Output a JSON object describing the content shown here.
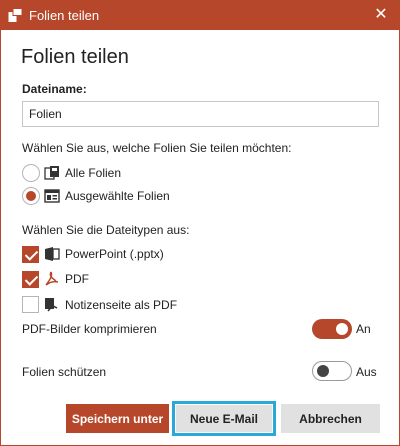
{
  "window": {
    "title": "Folien teilen",
    "close_glyph": "✕"
  },
  "heading": "Folien teilen",
  "filename": {
    "label": "Dateiname:",
    "value": "Folien"
  },
  "slides": {
    "prompt": "Wählen Sie aus, welche Folien Sie teilen möchten:",
    "options": [
      {
        "label": "Alle Folien",
        "icon": "all-slides-icon",
        "selected": false
      },
      {
        "label": "Ausgewählte Folien",
        "icon": "selected-slides-icon",
        "selected": true
      }
    ]
  },
  "filetypes": {
    "prompt": "Wählen Sie die Dateitypen aus:",
    "options": [
      {
        "label": "PowerPoint (.pptx)",
        "icon": "powerpoint-icon",
        "checked": true
      },
      {
        "label": "PDF",
        "icon": "pdf-icon",
        "checked": true
      },
      {
        "label": "Notizenseite als PDF",
        "icon": "notes-page-pdf-icon",
        "checked": false
      }
    ]
  },
  "compress": {
    "label": "PDF-Bilder komprimieren",
    "state_label": "An",
    "on": true
  },
  "protect": {
    "label": "Folien schützen",
    "state_label": "Aus",
    "on": false
  },
  "buttons": {
    "save": "Speichern unter",
    "email": "Neue E-Mail",
    "cancel": "Abbrechen"
  },
  "colors": {
    "accent": "#b7472a",
    "focus": "#2aa8d8",
    "button_gray": "#e1e1e1"
  }
}
